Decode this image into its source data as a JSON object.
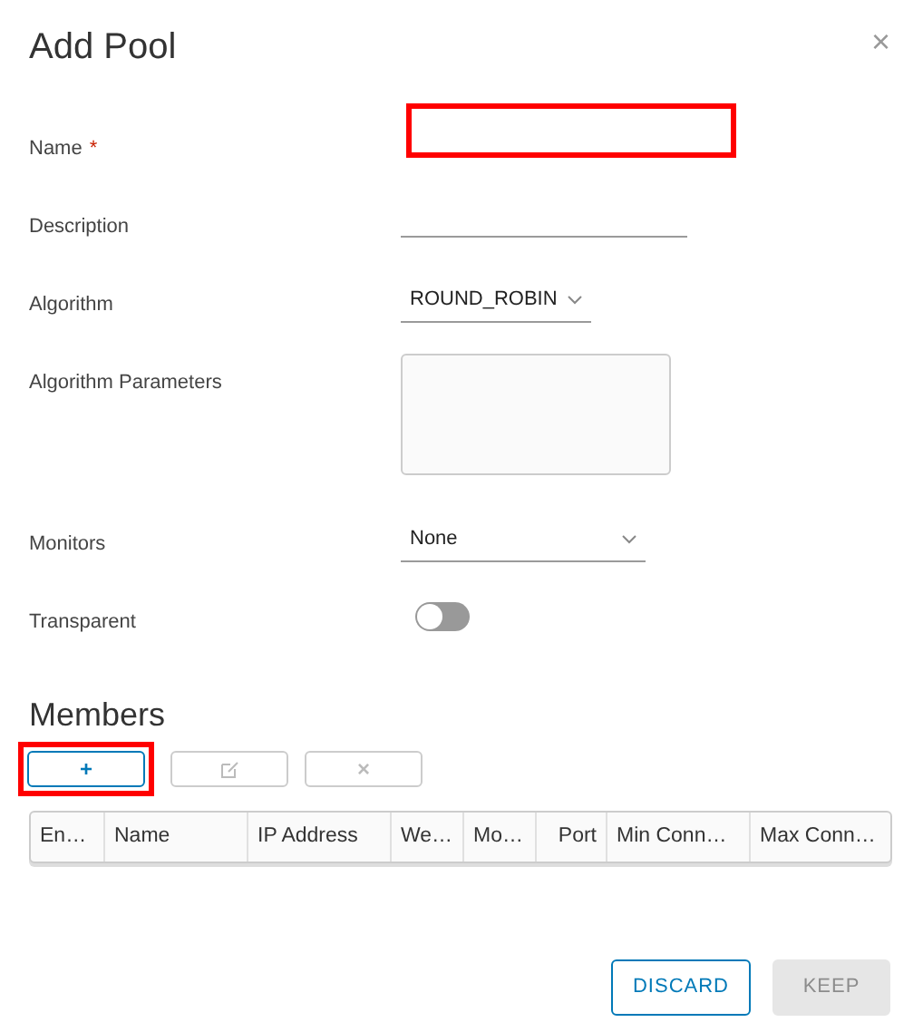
{
  "dialog": {
    "title": "Add Pool",
    "close": "×"
  },
  "fields": [
    {
      "kind": "text",
      "label": "Name",
      "required_mark": "*",
      "highlighted": true
    },
    {
      "kind": "line",
      "label": "Description"
    },
    {
      "kind": "select",
      "label": "Algorithm",
      "value": "ROUND_ROBIN"
    },
    {
      "kind": "textarea",
      "label": "Algorithm Parameters"
    },
    {
      "kind": "select-wide",
      "label": "Monitors",
      "value": "None"
    },
    {
      "kind": "toggle",
      "label": "Transparent",
      "on": false
    }
  ],
  "members": {
    "title": "Members",
    "toolbar": [
      {
        "kind": "add",
        "text": "+",
        "disabled": false,
        "highlighted": true
      },
      {
        "kind": "edit",
        "disabled": true
      },
      {
        "kind": "delete",
        "text": "×",
        "disabled": true
      }
    ],
    "columns": [
      "En…",
      "Name",
      "IP Address",
      "We…",
      "Mo…",
      "Port",
      "Min Conn…",
      "Max Conn…"
    ]
  },
  "buttons": [
    {
      "text": "DISCARD",
      "disabled": false
    },
    {
      "text": "KEEP",
      "disabled": true
    }
  ]
}
